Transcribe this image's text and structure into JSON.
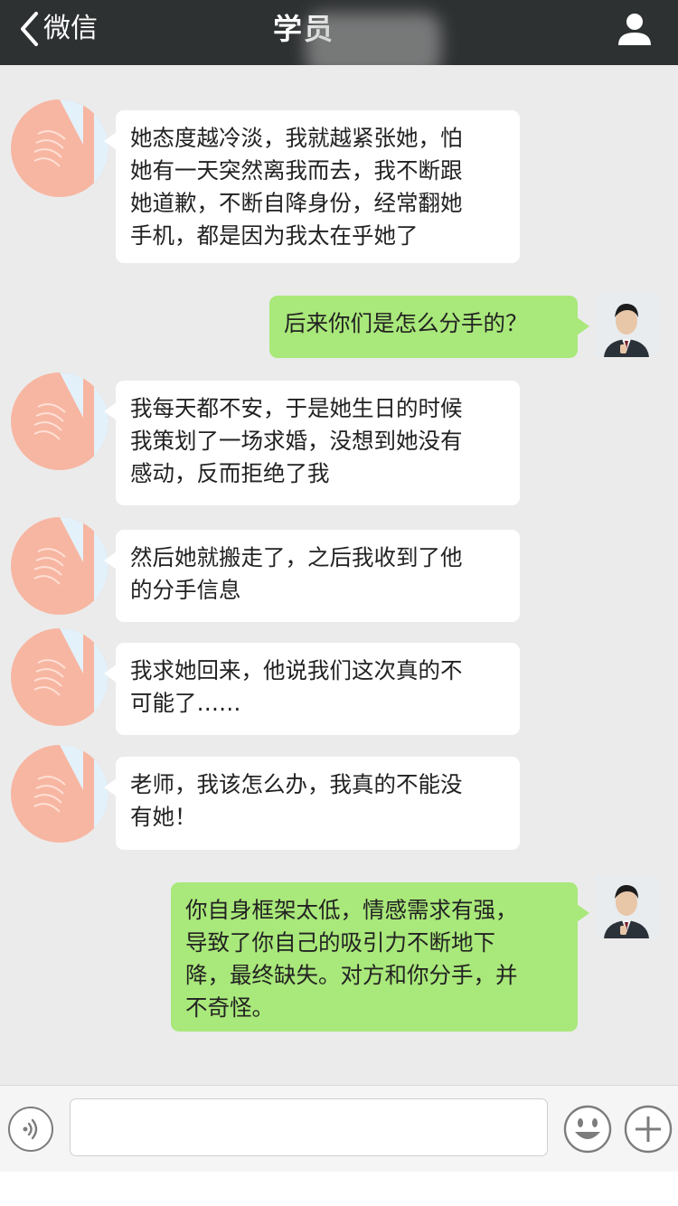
{
  "nav": {
    "back_label": "微信",
    "title": "学员",
    "profile_icon": "person-icon",
    "background": "#2e3132"
  },
  "messages": [
    {
      "from": "them",
      "text": "她态度越冷淡，我就越紧张她，怕\n她有一天突然离我而去，我不断跟\n她道歉，不断自降身份，经常翻她\n手机，都是因为我太在乎她了"
    },
    {
      "from": "me",
      "text": "后来你们是怎么分手的？"
    },
    {
      "from": "them",
      "text": "我每天都不安，于是她生日的时候\n我策划了一场求婚，没想到她没有\n感动，反而拒绝了我"
    },
    {
      "from": "them",
      "text": "然后她就搬走了，之后我收到了他\n的分手信息"
    },
    {
      "from": "them",
      "text": "我求她回来，他说我们这次真的不\n可能了……"
    },
    {
      "from": "them",
      "text": "老师，我该怎么办，我真的不能没\n有她！"
    },
    {
      "from": "me",
      "text": "你自身框架太低，情感需求有强，\n导致了你自己的吸引力不断地下\n降，最终缺失。对方和你分手，并\n不奇怪。"
    }
  ],
  "input": {
    "value": "",
    "placeholder": "",
    "voice_icon": "voice-icon",
    "emoji_icon": "emoji-icon",
    "plus_icon": "plus-icon"
  },
  "colors": {
    "chat_background": "#ebebeb",
    "incoming_bubble": "#ffffff",
    "outgoing_bubble": "#a9e87a"
  }
}
